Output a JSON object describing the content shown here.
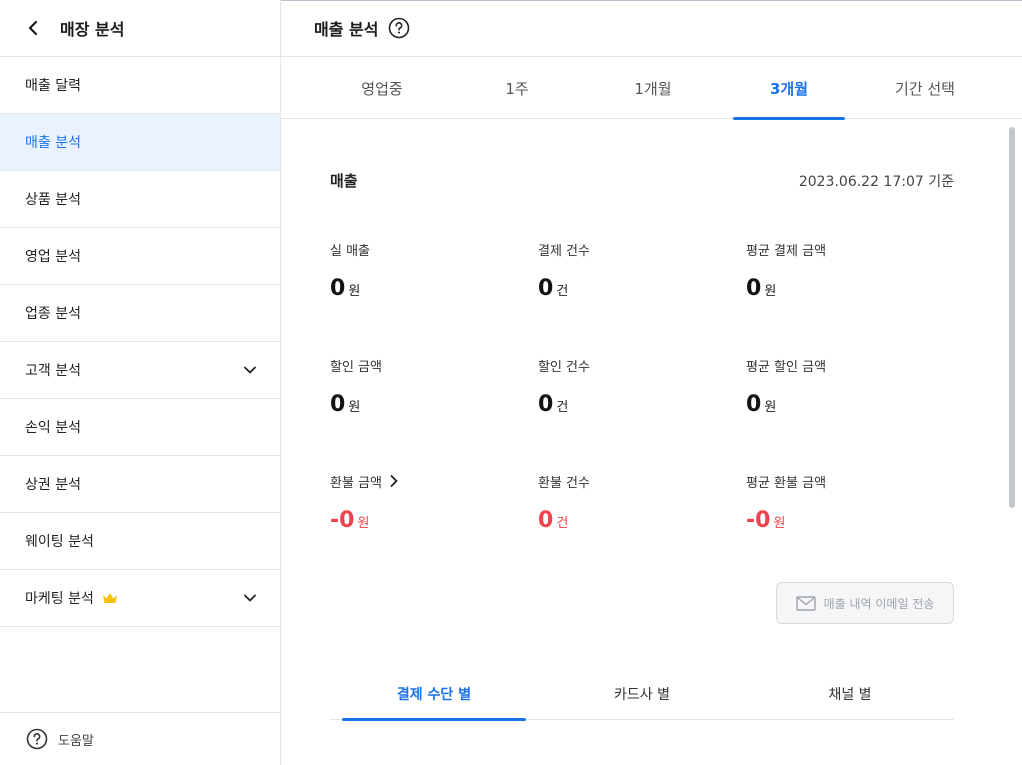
{
  "sidebar": {
    "title": "매장 분석",
    "items": [
      {
        "label": "매출 달력"
      },
      {
        "label": "매출 분석"
      },
      {
        "label": "상품 분석"
      },
      {
        "label": "영업 분석"
      },
      {
        "label": "업종 분석"
      },
      {
        "label": "고객 분석"
      },
      {
        "label": "손익 분석"
      },
      {
        "label": "상권 분석"
      },
      {
        "label": "웨이팅 분석"
      },
      {
        "label": "마케팅 분석"
      }
    ],
    "active_item": "매출 분석",
    "help_label": "도움말"
  },
  "header": {
    "title": "매출 분석"
  },
  "period_tabs": [
    {
      "label": "영업중"
    },
    {
      "label": "1주"
    },
    {
      "label": "1개월"
    },
    {
      "label": "3개월"
    },
    {
      "label": "기간 선택"
    }
  ],
  "active_period": "3개월",
  "sales": {
    "title": "매출",
    "timestamp": "2023.06.22 17:07 기준",
    "metrics": [
      {
        "label": "실 매출",
        "value": "0",
        "unit": "원"
      },
      {
        "label": "결제 건수",
        "value": "0",
        "unit": "건"
      },
      {
        "label": "평균 결제 금액",
        "value": "0",
        "unit": "원"
      },
      {
        "label": "할인 금액",
        "value": "0",
        "unit": "원"
      },
      {
        "label": "할인 건수",
        "value": "0",
        "unit": "건"
      },
      {
        "label": "평균 할인 금액",
        "value": "0",
        "unit": "원"
      },
      {
        "label": "환불 금액",
        "value": "-0",
        "unit": "원"
      },
      {
        "label": "환불 건수",
        "value": "0",
        "unit": "건"
      },
      {
        "label": "평균 환불 금액",
        "value": "-0",
        "unit": "원"
      }
    ],
    "email_button": "매출 내역 이메일 전송"
  },
  "sub_tabs": [
    {
      "label": "결제 수단 별"
    },
    {
      "label": "카드사 별"
    },
    {
      "label": "채널 별"
    }
  ],
  "active_sub_tab": "결제 수단 별",
  "colors": {
    "accent": "#1a73e8",
    "negative": "#f0424c",
    "active_bg": "#eaf3fd",
    "crown": "#f4c20d"
  }
}
